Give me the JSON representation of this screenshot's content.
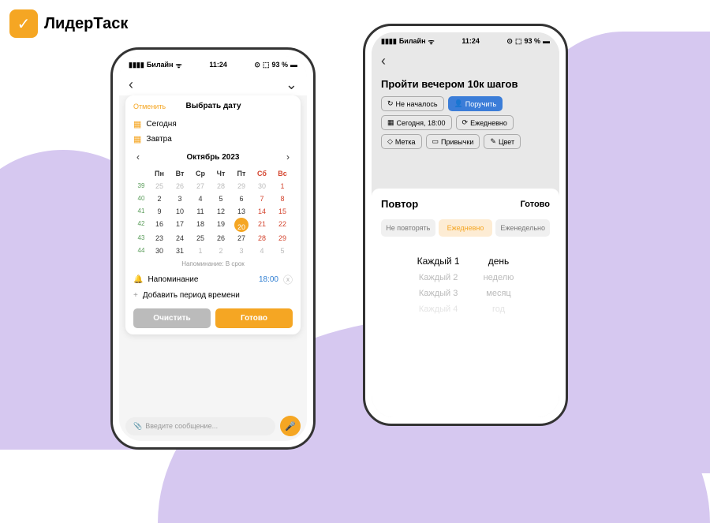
{
  "brand": {
    "name": "ЛидерТаск"
  },
  "status": {
    "carrier": "Билайн",
    "time": "11:24",
    "battery": "93 %"
  },
  "phone1": {
    "cancel": "Отменить",
    "title": "Выбрать дату",
    "today": "Сегодня",
    "tomorrow": "Завтра",
    "month": "Октябрь 2023",
    "dow": [
      "Пн",
      "Вт",
      "Ср",
      "Чт",
      "Пт",
      "Сб",
      "Вс"
    ],
    "weeks": [
      {
        "wk": "39",
        "days": [
          "25",
          "26",
          "27",
          "28",
          "29",
          "30",
          "1"
        ],
        "other": [
          0,
          1,
          2,
          3,
          4,
          5
        ]
      },
      {
        "wk": "40",
        "days": [
          "2",
          "3",
          "4",
          "5",
          "6",
          "7",
          "8"
        ]
      },
      {
        "wk": "41",
        "days": [
          "9",
          "10",
          "11",
          "12",
          "13",
          "14",
          "15"
        ]
      },
      {
        "wk": "42",
        "days": [
          "16",
          "17",
          "18",
          "19",
          "20",
          "21",
          "22"
        ],
        "sel": 4
      },
      {
        "wk": "43",
        "days": [
          "23",
          "24",
          "25",
          "26",
          "27",
          "28",
          "29"
        ]
      },
      {
        "wk": "44",
        "days": [
          "30",
          "31",
          "1",
          "2",
          "3",
          "4",
          "5"
        ],
        "other": [
          2,
          3,
          4,
          5,
          6
        ]
      }
    ],
    "sub_note": "Напоминание: В срок",
    "reminder": "Напоминание",
    "reminder_time": "18:00",
    "add_period": "Добавить период времени",
    "clear_btn": "Очистить",
    "done_btn": "Готово",
    "msg_placeholder": "Введите сообщение..."
  },
  "phone2": {
    "task_title": "Пройти вечером 10к шагов",
    "chips": {
      "status": "Не началось",
      "assign": "Поручить",
      "date": "Сегодня, 18:00",
      "repeat": "Ежедневно",
      "tag": "Метка",
      "habits": "Привычки",
      "color": "Цвет"
    },
    "repeat": {
      "title": "Повтор",
      "done": "Готово",
      "seg": [
        "Не повторять",
        "Ежедневно",
        "Еженедельно"
      ],
      "col1": [
        "Каждый 1",
        "Каждый 2",
        "Каждый 3",
        "Каждый 4"
      ],
      "col2": [
        "день",
        "неделю",
        "месяц",
        "год"
      ]
    }
  }
}
